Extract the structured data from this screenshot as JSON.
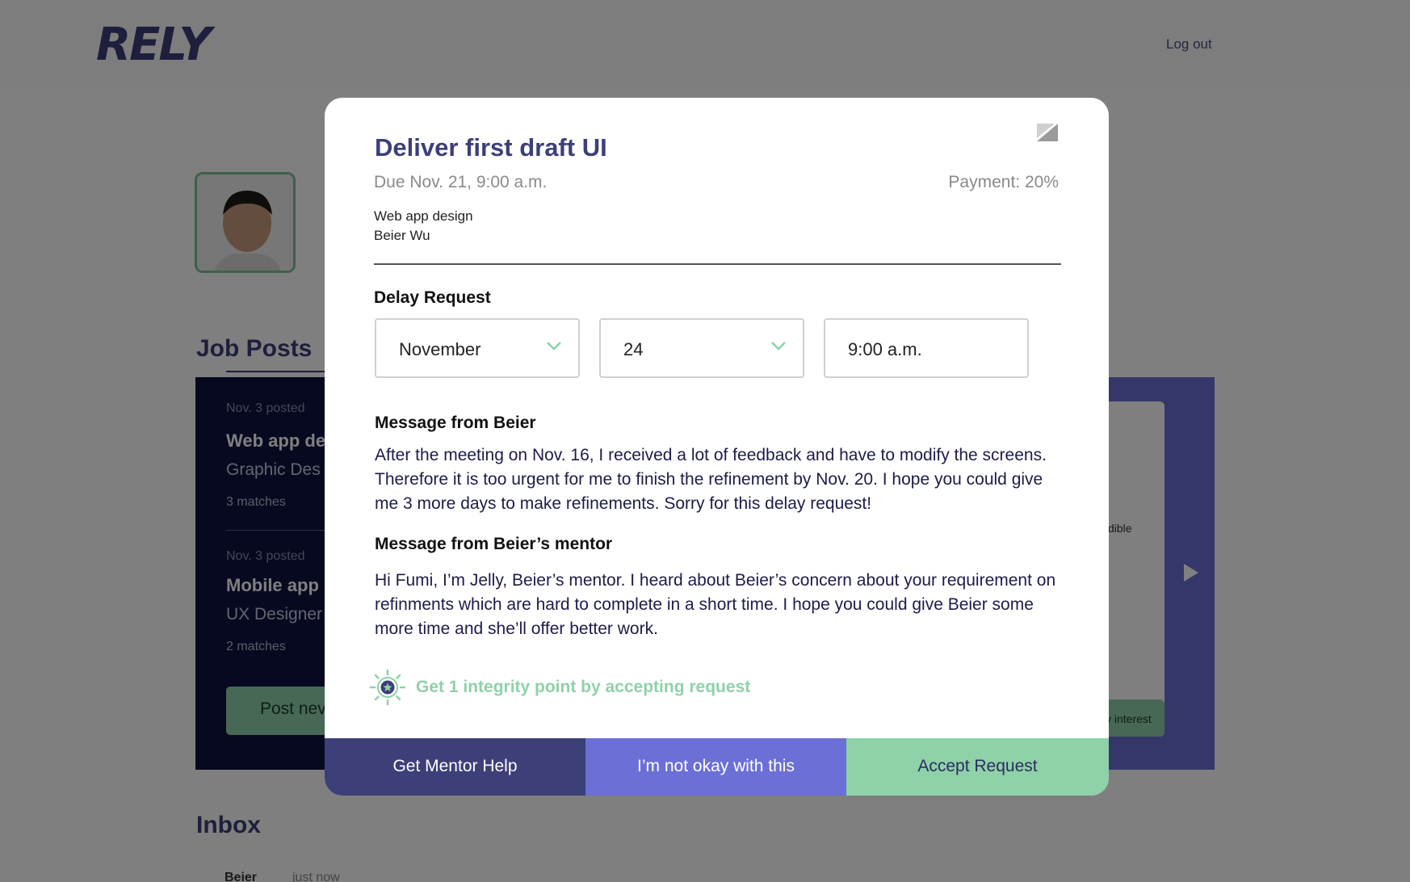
{
  "header": {
    "logo": "RELY",
    "logout_label": "Log out"
  },
  "job_posts": {
    "title": "Job Posts",
    "items": [
      {
        "posted": "Nov. 3 posted",
        "title": "Web app de",
        "role": "Graphic Des",
        "matches": "3 matches"
      },
      {
        "posted": "Nov. 3 posted",
        "title": "Mobile app",
        "role": "UX Designer",
        "matches": "2 matches"
      }
    ],
    "post_button_label": "Post nev",
    "card_snippet": "dible",
    "card_button_label": "v interest"
  },
  "inbox": {
    "title": "Inbox",
    "from": "Beier",
    "time": "just now"
  },
  "modal": {
    "title": "Deliver first draft UI",
    "due": "Due Nov. 21, 9:00 a.m.",
    "payment": "Payment: 20%",
    "project": "Web app design",
    "person": "Beier Wu",
    "delay_label": "Delay Request",
    "month": "November",
    "day": "24",
    "time": "9:00 a.m.",
    "message_heading": "Message from Beier",
    "message_text": "After the meeting on Nov. 16, I received a lot of feedback and have to modify the screens. Therefore it is too urgent for me to finish the refinement by Nov. 20. I hope you could give me 3 more days to make refinements. Sorry for this delay request!",
    "mentor_heading": "Message from Beier’s mentor",
    "mentor_text": "Hi Fumi, I’m Jelly, Beier’s mentor. I heard about Beier’s concern about your requirement on refinments which are hard to complete in a short time. I hope you could give Beier some more time and she’ll offer better work.",
    "perk_text": "Get 1 integrity point by accepting request",
    "buttons": {
      "mentor": "Get Mentor Help",
      "not_ok": "I’m not okay with this",
      "accept": "Accept Request"
    }
  },
  "colors": {
    "brand": "#3c3f78",
    "accent_purple": "#6b6fd6",
    "accent_green": "#8fd1a9",
    "dark_panel": "#0e1240"
  }
}
